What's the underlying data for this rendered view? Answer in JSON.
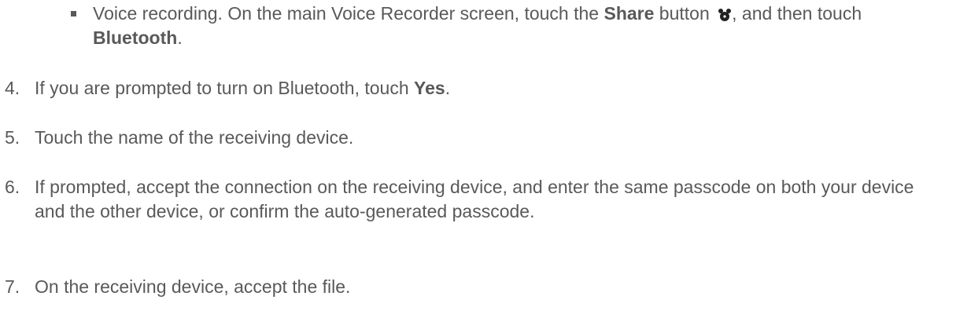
{
  "bullet": {
    "text_a": "Voice recording. On the main Voice Recorder screen, touch the ",
    "bold_a": "Share",
    "text_b": " button ",
    "text_c": ", and then touch ",
    "bold_b": "Bluetooth",
    "text_d": ".",
    "icon": "share-icon"
  },
  "steps": [
    {
      "number": "4.",
      "text_a": "If you are prompted to turn on Bluetooth, touch ",
      "bold": "Yes",
      "text_b": "."
    },
    {
      "number": "5.",
      "text": "Touch the name of the receiving device."
    },
    {
      "number": "6.",
      "text": "If prompted, accept the connection on the receiving device, and enter the same passcode on both your device and the other device, or confirm the auto-generated passcode."
    },
    {
      "number": "7.",
      "text": "On the receiving device, accept the file."
    }
  ]
}
